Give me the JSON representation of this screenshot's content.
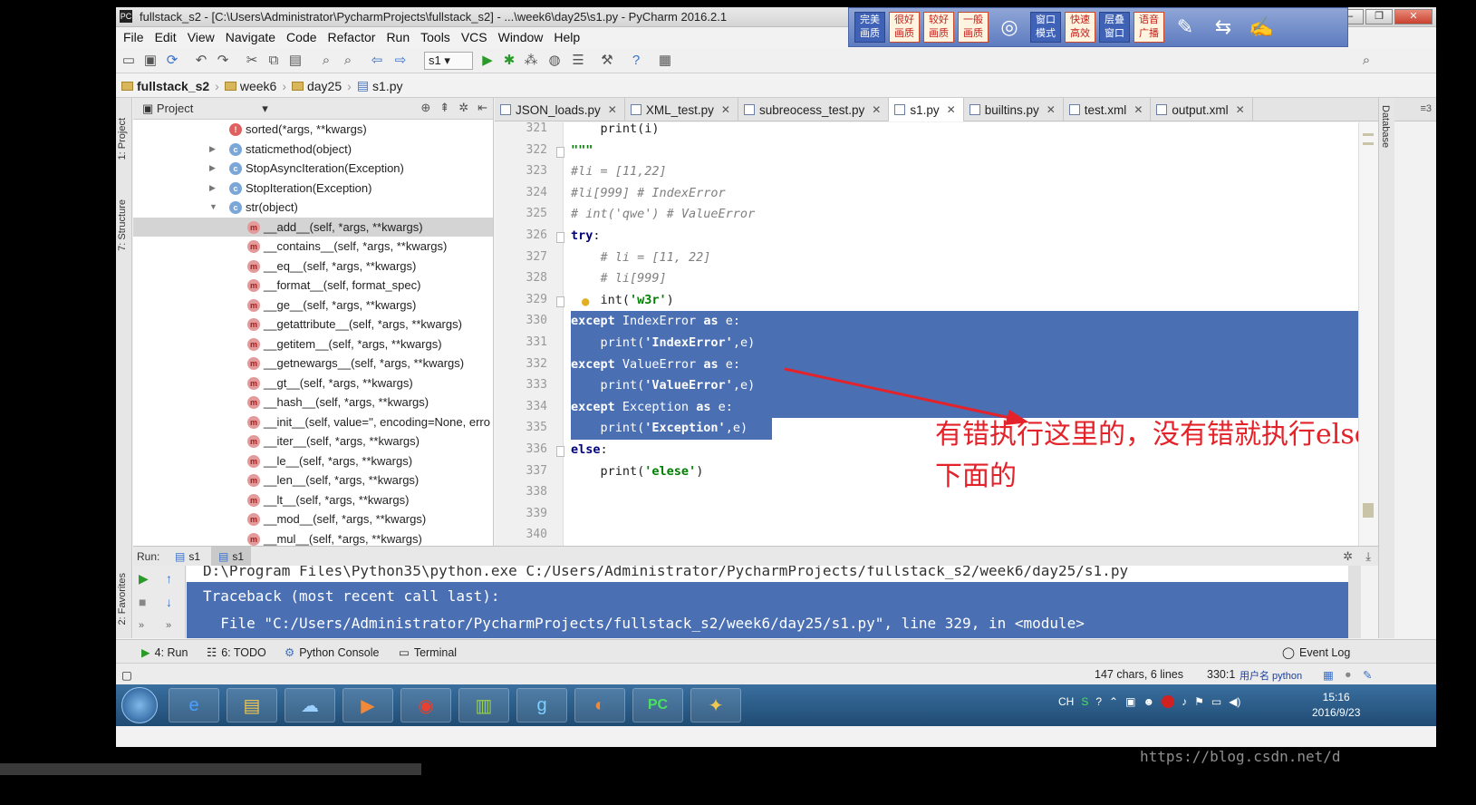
{
  "window": {
    "title": "fullstack_s2 - [C:\\Users\\Administrator\\PycharmProjects\\fullstack_s2] - ...\\week6\\day25\\s1.py - PyCharm 2016.2.1"
  },
  "ocr_toolbar": {
    "buttons": [
      "完美画质",
      "很好画质",
      "较好画质",
      "一般画质"
    ],
    "mode_buttons": [
      "窗口模式",
      "快速高效",
      "层叠窗口",
      "语音广播"
    ]
  },
  "menu": [
    "File",
    "Edit",
    "View",
    "Navigate",
    "Code",
    "Refactor",
    "Run",
    "Tools",
    "VCS",
    "Window",
    "Help"
  ],
  "toolbar": {
    "run_config": "s1"
  },
  "breadcrumb": [
    "fullstack_s2",
    "week6",
    "day25",
    "s1.py"
  ],
  "left_strip": {
    "project_tab": "1: Project",
    "structure_tab": "7: Structure",
    "favorites_tab": "2: Favorites"
  },
  "project_panel": {
    "title": "Project",
    "rows": [
      {
        "badge": "f",
        "text": "sorted(*args, **kwargs)",
        "indent": 0,
        "arrow": ""
      },
      {
        "badge": "c",
        "text": "staticmethod(object)",
        "indent": 0,
        "arrow": "▶"
      },
      {
        "badge": "c",
        "text": "StopAsyncIteration(Exception)",
        "indent": 0,
        "arrow": "▶"
      },
      {
        "badge": "c",
        "text": "StopIteration(Exception)",
        "indent": 0,
        "arrow": "▶"
      },
      {
        "badge": "c",
        "text": "str(object)",
        "indent": 0,
        "arrow": "▼"
      },
      {
        "badge": "m",
        "text": "__add__(self, *args, **kwargs)",
        "indent": 1,
        "arrow": "",
        "selected": true
      },
      {
        "badge": "m",
        "text": "__contains__(self, *args, **kwargs)",
        "indent": 1,
        "arrow": ""
      },
      {
        "badge": "m",
        "text": "__eq__(self, *args, **kwargs)",
        "indent": 1,
        "arrow": ""
      },
      {
        "badge": "m",
        "text": "__format__(self, format_spec)",
        "indent": 1,
        "arrow": ""
      },
      {
        "badge": "m",
        "text": "__ge__(self, *args, **kwargs)",
        "indent": 1,
        "arrow": ""
      },
      {
        "badge": "m",
        "text": "__getattribute__(self, *args, **kwargs)",
        "indent": 1,
        "arrow": ""
      },
      {
        "badge": "m",
        "text": "__getitem__(self, *args, **kwargs)",
        "indent": 1,
        "arrow": ""
      },
      {
        "badge": "m",
        "text": "__getnewargs__(self, *args, **kwargs)",
        "indent": 1,
        "arrow": ""
      },
      {
        "badge": "m",
        "text": "__gt__(self, *args, **kwargs)",
        "indent": 1,
        "arrow": ""
      },
      {
        "badge": "m",
        "text": "__hash__(self, *args, **kwargs)",
        "indent": 1,
        "arrow": ""
      },
      {
        "badge": "m",
        "text": "__init__(self, value='', encoding=None, erro",
        "indent": 1,
        "arrow": ""
      },
      {
        "badge": "m",
        "text": "__iter__(self, *args, **kwargs)",
        "indent": 1,
        "arrow": ""
      },
      {
        "badge": "m",
        "text": "__le__(self, *args, **kwargs)",
        "indent": 1,
        "arrow": ""
      },
      {
        "badge": "m",
        "text": "__len__(self, *args, **kwargs)",
        "indent": 1,
        "arrow": ""
      },
      {
        "badge": "m",
        "text": "__lt__(self, *args, **kwargs)",
        "indent": 1,
        "arrow": ""
      },
      {
        "badge": "m",
        "text": "__mod__(self, *args, **kwargs)",
        "indent": 1,
        "arrow": ""
      },
      {
        "badge": "m",
        "text": "__mul__(self, *args, **kwargs)",
        "indent": 1,
        "arrow": ""
      }
    ]
  },
  "editor_tabs": [
    {
      "name": "JSON_loads.py",
      "active": false
    },
    {
      "name": "XML_test.py",
      "active": false
    },
    {
      "name": "subreocess_test.py",
      "active": false
    },
    {
      "name": "s1.py",
      "active": true
    },
    {
      "name": "builtins.py",
      "active": false
    },
    {
      "name": "test.xml",
      "active": false
    },
    {
      "name": "output.xml",
      "active": false
    }
  ],
  "editor_tabs_more": "≡3",
  "editor": {
    "lines": [
      {
        "num": "321",
        "segs": [
          [
            "",
            "    "
          ],
          [
            "",
            "print(i)"
          ]
        ]
      },
      {
        "num": "322",
        "segs": [
          [
            "st",
            "\"\"\""
          ]
        ]
      },
      {
        "num": "323",
        "segs": [
          [
            "cm",
            "#li = [11,22]"
          ]
        ]
      },
      {
        "num": "324",
        "segs": [
          [
            "cm",
            "#li[999] # IndexError"
          ]
        ]
      },
      {
        "num": "325",
        "segs": [
          [
            "cm",
            "# int('qwe') # ValueError"
          ]
        ]
      },
      {
        "num": "326",
        "segs": [
          [
            "kw",
            "try"
          ],
          [
            "",
            ":"
          ]
        ]
      },
      {
        "num": "327",
        "segs": [
          [
            "",
            "    "
          ],
          [
            "cm",
            "# li = [11, 22]"
          ]
        ]
      },
      {
        "num": "328",
        "segs": [
          [
            "",
            "    "
          ],
          [
            "cm",
            "# li[999]"
          ]
        ]
      },
      {
        "num": "329",
        "segs": [
          [
            "",
            "    int("
          ],
          [
            "st",
            "'w3r'"
          ],
          [
            "",
            ")"
          ]
        ]
      },
      {
        "num": "330",
        "segs": [
          [
            "kw",
            "except "
          ],
          [
            "",
            "IndexError "
          ],
          [
            "kw",
            "as "
          ],
          [
            "",
            "e:"
          ]
        ],
        "sel": true
      },
      {
        "num": "331",
        "segs": [
          [
            "",
            "    print("
          ],
          [
            "st",
            "'IndexError'"
          ],
          [
            "",
            ",e)"
          ]
        ],
        "sel": true
      },
      {
        "num": "332",
        "segs": [
          [
            "kw",
            "except "
          ],
          [
            "",
            "ValueError "
          ],
          [
            "kw",
            "as "
          ],
          [
            "",
            "e:"
          ]
        ],
        "sel": true
      },
      {
        "num": "333",
        "segs": [
          [
            "",
            "    print("
          ],
          [
            "st",
            "'ValueError'"
          ],
          [
            "",
            ",e)"
          ]
        ],
        "sel": true
      },
      {
        "num": "334",
        "segs": [
          [
            "kw",
            "except "
          ],
          [
            "",
            "Exception "
          ],
          [
            "kw",
            "as "
          ],
          [
            "",
            "e:"
          ]
        ],
        "sel": true
      },
      {
        "num": "335",
        "segs": [
          [
            "",
            "    print("
          ],
          [
            "st",
            "'Exception'"
          ],
          [
            "",
            ",e)"
          ]
        ],
        "sel": true
      },
      {
        "num": "336",
        "segs": [
          [
            "kw",
            "else"
          ],
          [
            "",
            ":"
          ]
        ]
      },
      {
        "num": "337",
        "segs": [
          [
            "",
            "    print("
          ],
          [
            "st",
            "'elese'"
          ],
          [
            "",
            ")"
          ]
        ]
      },
      {
        "num": "338",
        "segs": []
      },
      {
        "num": "339",
        "segs": []
      },
      {
        "num": "340",
        "segs": []
      }
    ],
    "annotation": "有错执行这里的，没有错就执行else下面的"
  },
  "run_panel": {
    "label": "Run:",
    "tabs": [
      "s1",
      "s1"
    ],
    "console": [
      "D:\\Program Files\\Python35\\python.exe C:/Users/Administrator/PycharmProjects/fullstack_s2/week6/day25/s1.py",
      "Traceback (most recent call last):",
      "  File \"C:/Users/Administrator/PycharmProjects/fullstack_s2/week6/day25/s1.py\", line 329, in <module>"
    ]
  },
  "tool_windows": {
    "run": "4: Run",
    "todo": "6: TODO",
    "python_console": "Python Console",
    "terminal": "Terminal",
    "event_log": "Event Log"
  },
  "status": {
    "chars": "147 chars, 6 lines",
    "position": "330:1",
    "user_name": "用户名 python"
  },
  "taskbar": {
    "tray_lang": "CH",
    "time": "15:16",
    "date": "2016/9/23"
  },
  "watermark": "https://blog.csdn.net/d"
}
